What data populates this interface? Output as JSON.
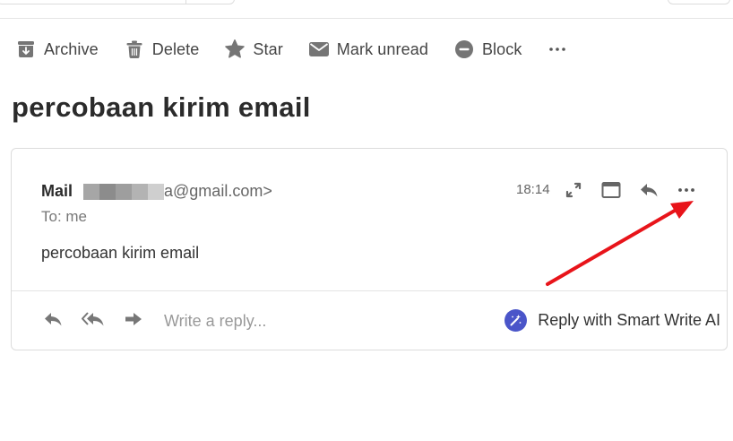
{
  "toolbar": {
    "archive": "Archive",
    "delete": "Delete",
    "star": "Star",
    "mark_unread": "Mark unread",
    "block": "Block"
  },
  "subject": "percobaan kirim email",
  "message": {
    "sender_name": "Mail",
    "sender_email_visible": "a@gmail.com>",
    "to": "To: me",
    "time": "18:14",
    "body": "percobaan kirim email"
  },
  "reply": {
    "placeholder": "Write a reply...",
    "smart_write": "Reply with Smart Write AI"
  },
  "icons": {
    "archive": "archive-icon",
    "delete": "trash-icon",
    "star": "star-icon",
    "mark_unread": "envelope-icon",
    "block": "block-icon",
    "more": "more-horizontal-icon",
    "expand": "expand-icon",
    "window": "window-icon",
    "reply": "reply-icon",
    "reply_all": "reply-all-icon",
    "forward": "forward-icon",
    "wand": "magic-wand-icon"
  },
  "colors": {
    "icon_gray": "#757575",
    "smart_write_accent": "#4a55c9",
    "annotation_arrow": "#e8141a"
  }
}
